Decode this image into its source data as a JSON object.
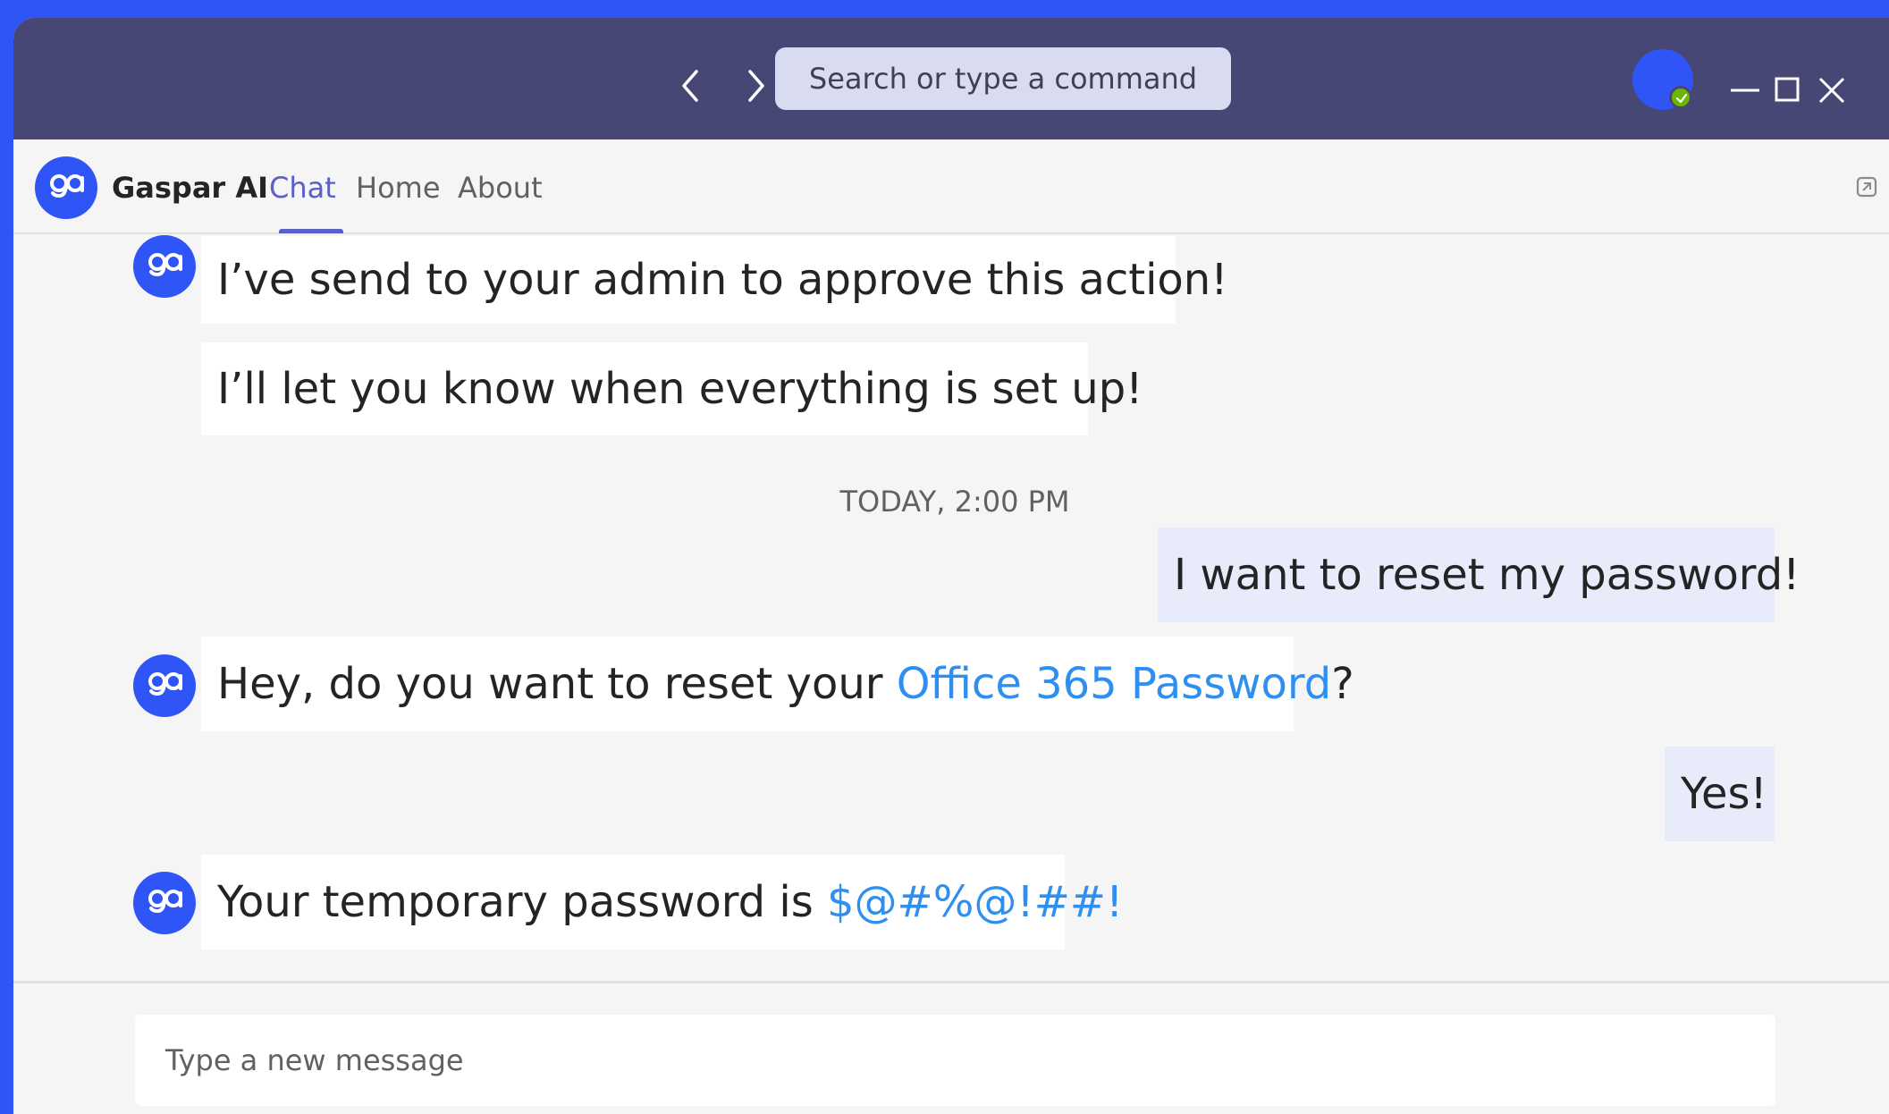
{
  "titlebar": {
    "search_placeholder": "Search or type a command"
  },
  "app": {
    "name": "Gaspar AI",
    "tabs": [
      {
        "label": "Chat",
        "active": true
      },
      {
        "label": "Home",
        "active": false
      },
      {
        "label": "About",
        "active": false
      }
    ]
  },
  "conversation": {
    "messages": [
      {
        "sender": "bot",
        "text": "I’ve send to your admin to approve this action!"
      },
      {
        "sender": "bot",
        "text": "I’ll let you know when everything is set up!"
      },
      {
        "sender": "user",
        "text": "I want to reset my password!"
      },
      {
        "sender": "bot",
        "text_before": "Hey, do you want to reset your ",
        "link": "Office 365 Password",
        "text_after": "?"
      },
      {
        "sender": "user",
        "text": "Yes!"
      },
      {
        "sender": "bot",
        "text_before": "Your temporary password is ",
        "link": "$@#%@!##!"
      }
    ],
    "timestamp": "TODAY, 2:00 PM"
  },
  "composer": {
    "placeholder": "Type a new message"
  },
  "colors": {
    "background": "#2f55f7",
    "titlebar": "#464775",
    "accent": "#5b5fc7",
    "link": "#2f8ff0",
    "user_bubble": "#e8ebfa",
    "presence_available": "#6bb700"
  }
}
